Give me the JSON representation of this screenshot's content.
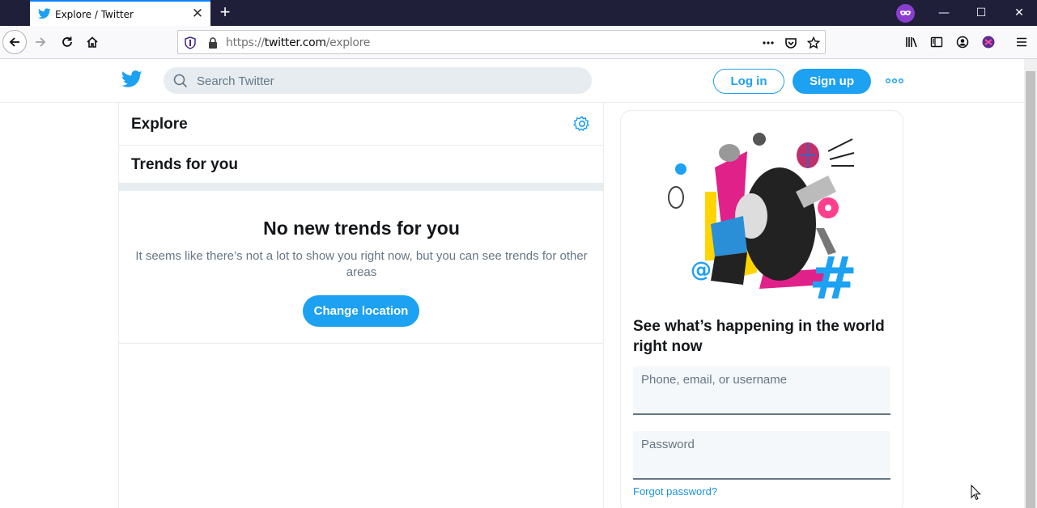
{
  "browser": {
    "tab_title": "Explore / Twitter",
    "close_glyph": "✕",
    "newtab_glyph": "+",
    "url_prefix": "https://",
    "url_host": "twitter.com",
    "url_path": "/explore",
    "window_controls": {
      "minimize": "—",
      "maximize": "☐",
      "close": "✕"
    },
    "accent": "#0a84ff"
  },
  "header": {
    "search_placeholder": "Search Twitter",
    "login_label": "Log in",
    "signup_label": "Sign up",
    "brand_color": "#1da1f2"
  },
  "explore": {
    "title": "Explore",
    "trends_title": "Trends for you",
    "empty_title": "No new trends for you",
    "empty_text": "It seems like there’s not a lot to show you right now, but you can see trends for other areas",
    "change_location_label": "Change location"
  },
  "sidebar": {
    "headline": "See what’s happening in the world right now",
    "username_label": "Phone, email, or username",
    "password_label": "Password",
    "forgot_label": "Forgot password?"
  }
}
